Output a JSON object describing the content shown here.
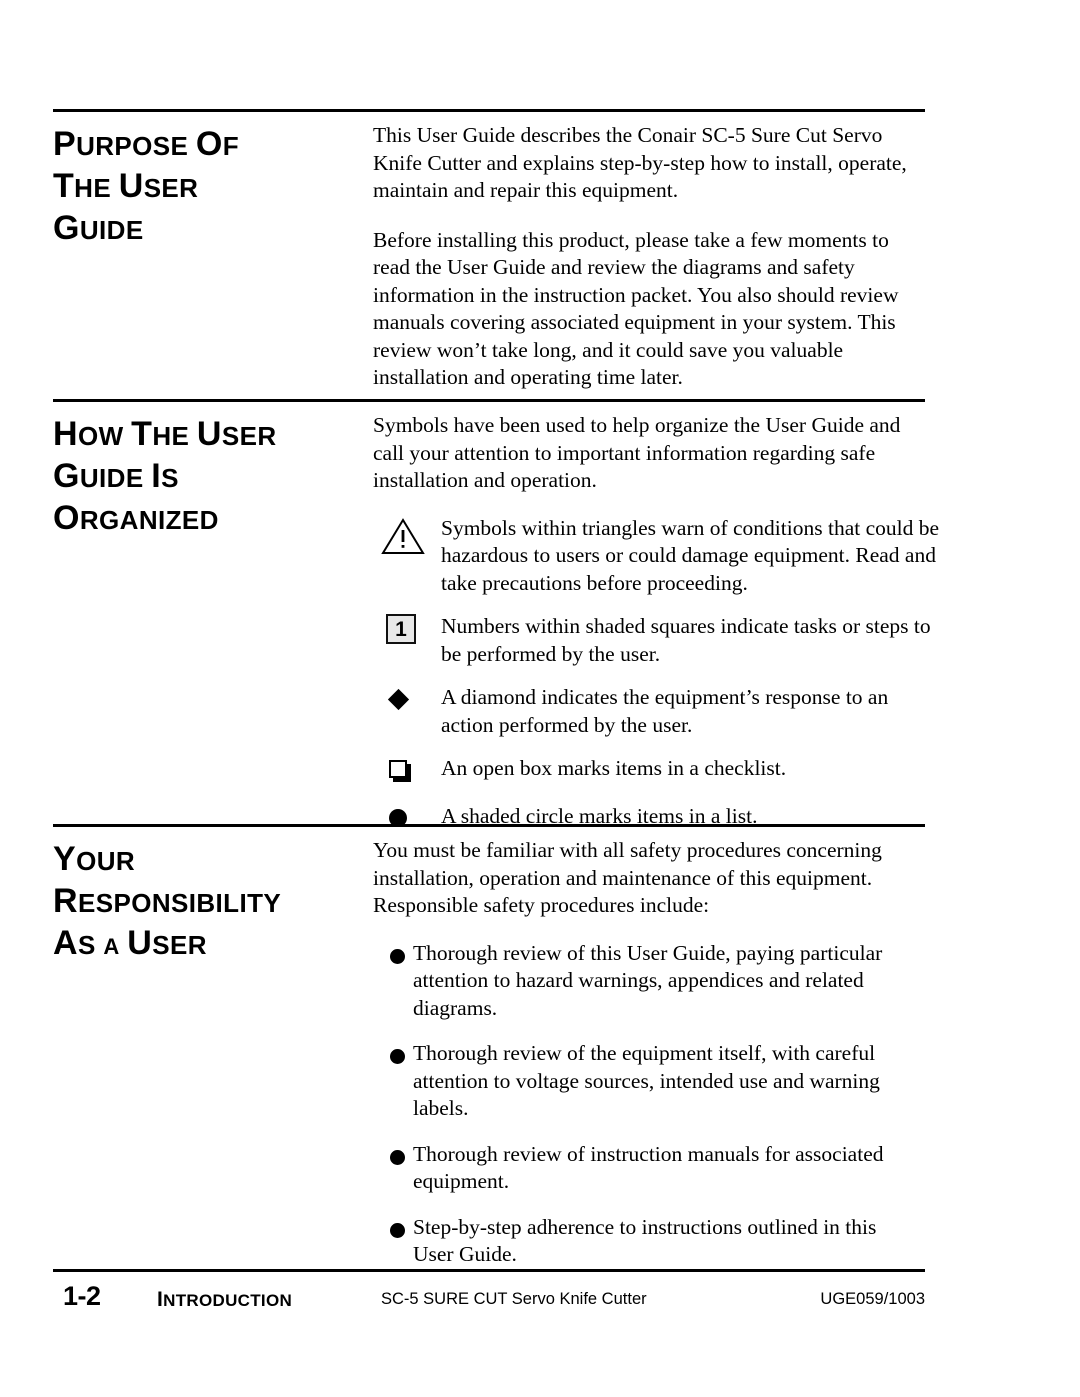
{
  "document": {
    "sections": [
      {
        "id": "purpose-of-the-user-guide",
        "heading_lines": [
          {
            "cap": "P",
            "rest": "URPOSE",
            "cap2": "O",
            "rest2": "F"
          },
          {
            "cap": "T",
            "rest": "HE",
            "cap2": "U",
            "rest2": "SER"
          },
          {
            "cap": "G",
            "rest": "UIDE"
          }
        ],
        "heading_text": "PURPOSE OF THE USER GUIDE",
        "paragraphs": [
          "This User Guide describes the Conair SC-5 Sure Cut Servo Knife Cutter and explains step-by-step how to install, operate, maintain and repair this equipment.",
          "Before installing this product, please take a few moments to read the User Guide and review the diagrams and safety information in the instruction packet. You also should review manuals covering associated equipment in your system. This review won’t take long, and it could save you valuable installation and operating time later."
        ]
      },
      {
        "id": "how-the-user-guide-is-organized",
        "heading_text": "HOW THE USER GUIDE IS ORGANIZED",
        "intro": "Symbols have been used to help organize the User Guide and call your attention to important information regarding safe installation and operation.",
        "symbols": [
          {
            "icon": "warning-triangle-icon",
            "text": "Symbols within triangles warn of conditions that could be hazardous to users or could damage equipment. Read and take precautions before proceeding."
          },
          {
            "icon": "numbered-square-icon",
            "number": "1",
            "text": "Numbers within shaded squares indicate tasks or steps to be performed by the user."
          },
          {
            "icon": "filled-diamond-icon",
            "text": "A diamond indicates the equipment’s response to an action performed by the user."
          },
          {
            "icon": "open-box-icon",
            "text": "An open box marks items in a checklist."
          },
          {
            "icon": "filled-circle-icon",
            "text": "A shaded circle marks items in a list."
          }
        ]
      },
      {
        "id": "your-responsibility-as-a-user",
        "heading_text": "YOUR RESPONSIBILITY AS A USER",
        "intro": "You must be familiar with all safety procedures concerning installation, operation and maintenance of this equipment. Responsible safety procedures include:",
        "bullets": [
          "Thorough review of this User Guide, paying particular attention to hazard warnings, appendices and related diagrams.",
          "Thorough review of the equipment itself, with careful attention to voltage sources, intended use and warning labels.",
          "Thorough review of instruction manuals for associated equipment.",
          "Step-by-step adherence to instructions outlined in this User Guide."
        ]
      }
    ]
  },
  "headings": {
    "sec1": {
      "l1a": "P",
      "l1b": "URPOSE ",
      "l1c": "O",
      "l1d": "F",
      "l2a": "T",
      "l2b": "HE ",
      "l2c": "U",
      "l2d": "SER",
      "l3a": "G",
      "l3b": "UIDE"
    },
    "sec2": {
      "l1a": "H",
      "l1b": "OW ",
      "l1c": "T",
      "l1d": "HE ",
      "l1e": "U",
      "l1f": "SER",
      "l2a": "G",
      "l2b": "UIDE ",
      "l2c": "I",
      "l2d": "S",
      "l3a": "O",
      "l3b": "RGANIZED"
    },
    "sec3": {
      "l1a": "Y",
      "l1b": "OUR",
      "l2a": "R",
      "l2b": "ESPONSIBILITY",
      "l3a": "A",
      "l3b": "S ",
      "l3c": "A",
      "l3d": " ",
      "l3e": "U",
      "l3f": "SER"
    }
  },
  "sec1": {
    "p1": "This User Guide describes the Conair SC-5 Sure Cut Servo Knife Cutter and explains step-by-step how to install, operate, maintain and repair this equipment.",
    "p2": "Before installing this product, please take a few moments to read the User Guide and review the diagrams and safety information in the instruction packet. You also should review manuals covering associated equipment in your system. This review won’t take long, and it could save you valuable installation and operating time later."
  },
  "sec2": {
    "intro": "Symbols have been used to help organize the User Guide and call your attention to important information regarding safe installation and operation.",
    "sym1": "Symbols within triangles warn of conditions that could be hazardous to users or could damage equipment. Read and take precautions before proceeding.",
    "sym2": "Numbers within shaded squares indicate tasks or steps to be performed by the user.",
    "sym2_number": "1",
    "sym3": "A diamond indicates the equipment’s response to an action performed by the user.",
    "sym4": "An open box marks items in a checklist.",
    "sym5": "A shaded circle marks items in a list."
  },
  "sec3": {
    "intro": "You must be familiar with all safety procedures concerning installation, operation and maintenance of this equipment. Responsible safety procedures include:",
    "b1": "Thorough review of this User Guide, paying particular attention to hazard warnings, appendices and related diagrams.",
    "b2": "Thorough review of the equipment itself, with careful attention to voltage sources, intended use and warning labels.",
    "b3": "Thorough review of instruction manuals for associated equipment.",
    "b4": "Step-by-step adherence to instructions outlined in this User Guide."
  },
  "footer": {
    "page_number": "1-2",
    "chapter_cap": "I",
    "chapter_rest": "NTRODUCTION",
    "chapter_full": "INTRODUCTION",
    "product_title": "SC-5 SURE CUT Servo Knife Cutter",
    "doc_code": "UGE059/1003"
  },
  "colors": {
    "text": "#000000",
    "background": "#ffffff",
    "rule": "#000000",
    "square_fill": "#e8e8e8"
  }
}
